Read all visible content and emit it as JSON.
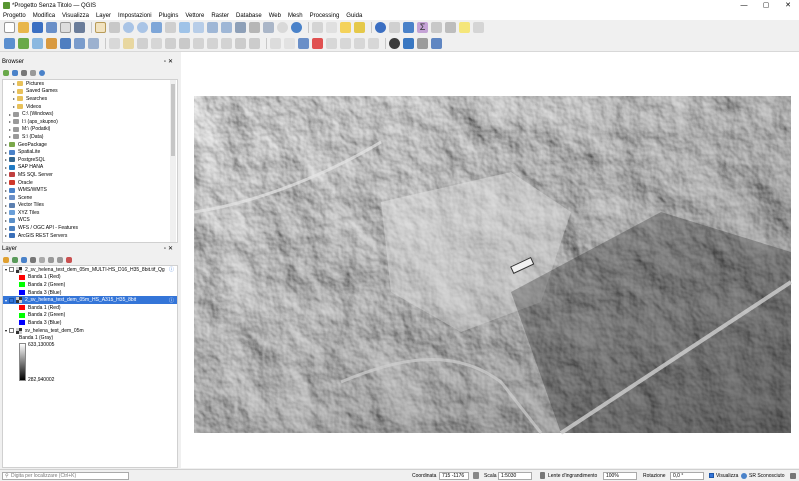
{
  "window": {
    "title": "*Progetto Senza Titolo — QGIS",
    "controls": [
      "—",
      "▢",
      "✕"
    ]
  },
  "menu": [
    "Progetto",
    "Modifica",
    "Visualizza",
    "Layer",
    "Impostazioni",
    "Plugins",
    "Vettore",
    "Raster",
    "Database",
    "Web",
    "Mesh",
    "Processing",
    "Guida"
  ],
  "browser": {
    "title": "Browser",
    "items": [
      {
        "label": "Pictures",
        "icon": "folder-icon",
        "indent": 2
      },
      {
        "label": "Saved Games",
        "icon": "folder-icon",
        "indent": 2
      },
      {
        "label": "Searches",
        "icon": "folder-icon",
        "indent": 2
      },
      {
        "label": "Videos",
        "icon": "folder-icon",
        "indent": 2
      },
      {
        "label": "C:\\ (Windows)",
        "icon": "drive-icon",
        "indent": 1
      },
      {
        "label": "I:\\ (aps_skupno)",
        "icon": "drive-icon",
        "indent": 1
      },
      {
        "label": "M:\\ (Podatki)",
        "icon": "drive-icon",
        "indent": 1
      },
      {
        "label": "S:\\ (Data)",
        "icon": "drive-icon",
        "indent": 1
      },
      {
        "label": "GeoPackage",
        "icon": "geopackage-icon",
        "indent": 0
      },
      {
        "label": "SpatiaLite",
        "icon": "spatialite-icon",
        "indent": 0
      },
      {
        "label": "PostgreSQL",
        "icon": "postgresql-icon",
        "indent": 0
      },
      {
        "label": "SAP HANA",
        "icon": "saphana-icon",
        "indent": 0
      },
      {
        "label": "MS SQL Server",
        "icon": "mssql-icon",
        "indent": 0
      },
      {
        "label": "Oracle",
        "icon": "oracle-icon",
        "indent": 0
      },
      {
        "label": "WMS/WMTS",
        "icon": "wms-icon",
        "indent": 0
      },
      {
        "label": "Scene",
        "icon": "scene-icon",
        "indent": 0
      },
      {
        "label": "Vector Tiles",
        "icon": "vectortiles-icon",
        "indent": 0
      },
      {
        "label": "XYZ Tiles",
        "icon": "xyztiles-icon",
        "indent": 0
      },
      {
        "label": "WCS",
        "icon": "wcs-icon",
        "indent": 0
      },
      {
        "label": "WFS / OGC API - Features",
        "icon": "wfs-icon",
        "indent": 0
      },
      {
        "label": "ArcGIS REST Servers",
        "icon": "arcgis-icon",
        "indent": 0
      }
    ]
  },
  "layers": {
    "title": "Layer",
    "items": [
      {
        "type": "layer",
        "label": "2_sv_helena_test_dem_05m_MULTI-HS_D16_H35_8bit.tif_Qg",
        "checked": false,
        "selected": false,
        "info": "ⓘ"
      },
      {
        "type": "band",
        "label": "Banda 1 (Red)",
        "color": "#ff0000"
      },
      {
        "type": "band",
        "label": "Banda 2 (Green)",
        "color": "#00ff00"
      },
      {
        "type": "band",
        "label": "Banda 3 (Blue)",
        "color": "#0000ff"
      },
      {
        "type": "layer",
        "label": "2_sv_helena_test_dem_05m_HS_A315_H35_8bit",
        "checked": true,
        "selected": true,
        "info": "ⓘ"
      },
      {
        "type": "band",
        "label": "Banda 1 (Red)",
        "color": "#ff0000"
      },
      {
        "type": "band",
        "label": "Banda 2 (Green)",
        "color": "#00ff00"
      },
      {
        "type": "band",
        "label": "Banda 3 (Blue)",
        "color": "#0000ff"
      },
      {
        "type": "layer",
        "label": "sv_helena_test_dem_05m",
        "checked": false,
        "selected": false,
        "info": ""
      },
      {
        "type": "band",
        "label": "Banda 1 (Gray)",
        "color": ""
      }
    ],
    "gradient_max": "633,130005",
    "gradient_min": "282,940002"
  },
  "status": {
    "locator_placeholder": "Digita per localizzare (Ctrl+K)",
    "coordinate_label": "Coordinata",
    "coordinate_value": "715 -1176",
    "scale_label": "Scala",
    "scale_value": "1:5030",
    "magnifier_label": "Lente d'ingrandimento",
    "magnifier_value": "100%",
    "rotation_label": "Rotazione",
    "rotation_value": "0,0 °",
    "render_label": "Visualizza",
    "crs_label": "SR Sconosciuto"
  },
  "colors": {
    "selection": "#3475d8",
    "qgis_green": "#589632"
  }
}
